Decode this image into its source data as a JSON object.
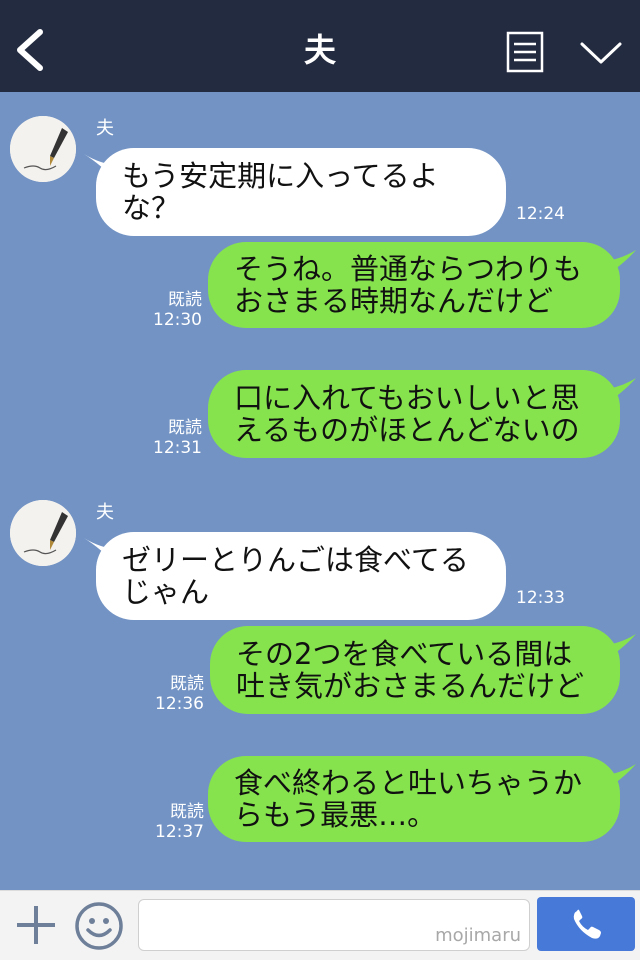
{
  "header": {
    "title": "夫",
    "back_icon": "chevron-left-icon",
    "menu_icon": "menu-icon",
    "collapse_icon": "chevron-down-icon"
  },
  "colors": {
    "header_bg": "#232b40",
    "chat_bg": "#7293c4",
    "incoming_bubble": "#ffffff",
    "outgoing_bubble": "#86e34e",
    "call_button": "#4779d9"
  },
  "messages": [
    {
      "direction": "incoming",
      "sender": "夫",
      "text": "もう安定期に入ってるよな？",
      "time": "12:24"
    },
    {
      "direction": "outgoing",
      "read_label": "既読",
      "text": "そうね。普通ならつわりもおさまる時期なんだけど",
      "time": "12:30"
    },
    {
      "direction": "outgoing",
      "read_label": "既読",
      "text": "口に入れてもおいしいと思えるものがほとんどないの",
      "time": "12:31"
    },
    {
      "direction": "incoming",
      "sender": "夫",
      "text": "ゼリーとりんごは食べてるじゃん",
      "time": "12:33"
    },
    {
      "direction": "outgoing",
      "read_label": "既読",
      "text": "その2つを食べている間は吐き気がおさまるんだけど",
      "time": "12:36"
    },
    {
      "direction": "outgoing",
      "read_label": "既読",
      "text": "食べ終わると吐いちゃうからもう最悪…。",
      "time": "12:37"
    }
  ],
  "footer": {
    "plus_icon": "plus-icon",
    "emoji_icon": "smiley-icon",
    "input_value": "",
    "watermark": "mojimaru",
    "call_icon": "phone-icon"
  }
}
